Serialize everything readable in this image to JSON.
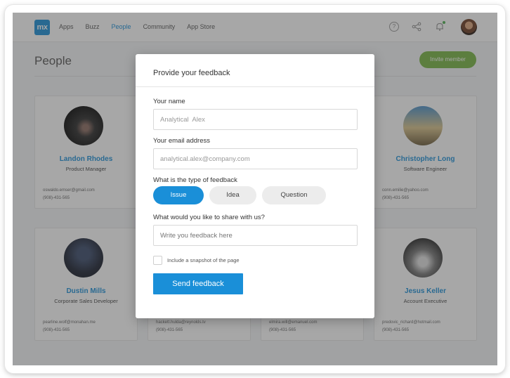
{
  "brand": {
    "logo_text": "mx",
    "accent": "#1a8fd8",
    "green": "#77b543"
  },
  "nav": {
    "items": [
      "Apps",
      "Buzz",
      "People",
      "Community",
      "App Store"
    ],
    "active": "People"
  },
  "header_icons": [
    "help-icon",
    "share-icon",
    "bell-icon",
    "profile-avatar"
  ],
  "page": {
    "title": "People",
    "invite_label": "Invite member"
  },
  "cards": [
    {
      "name": "Landon Rhodes",
      "role": "Product Manager",
      "email": "oswaldo.emser@gmail.com",
      "phone": "(908)-431-565"
    },
    {
      "name": "Christopher Long",
      "role": "Software Engineer",
      "email": "conn.emilie@yahoo.com",
      "phone": "(908)-431-565"
    },
    {
      "name": "Dustin Mills",
      "role": "Corporate Sales Developer",
      "email": "pearline.wolf@monahan.me",
      "phone": "(908)-431-565"
    },
    {
      "name": "",
      "role": "",
      "email": "hackett.hulda@reynolds.tv",
      "phone": "(908)-431-565"
    },
    {
      "name": "",
      "role": "",
      "email": "elmira.will@emanuel.com",
      "phone": "(908)-431-565"
    },
    {
      "name": "Jesus Keller",
      "role": "Account Executive",
      "email": "predovic_richard@hotmail.com",
      "phone": "(908)-431-565"
    }
  ],
  "modal": {
    "title": "Provide your feedback",
    "name_label": "Your name",
    "name_value": "Analytical  Alex",
    "email_label": "Your email address",
    "email_value": "analytical.alex@company.com",
    "type_label": "What is the type of feedback",
    "types": [
      "Issue",
      "Idea",
      "Question"
    ],
    "selected_type": "Issue",
    "message_label": "What would you like to share with us?",
    "message_placeholder": "Write you feedback here",
    "snapshot_label": "Include a snapshot of the page",
    "snapshot_checked": false,
    "submit_label": "Send feedback"
  }
}
